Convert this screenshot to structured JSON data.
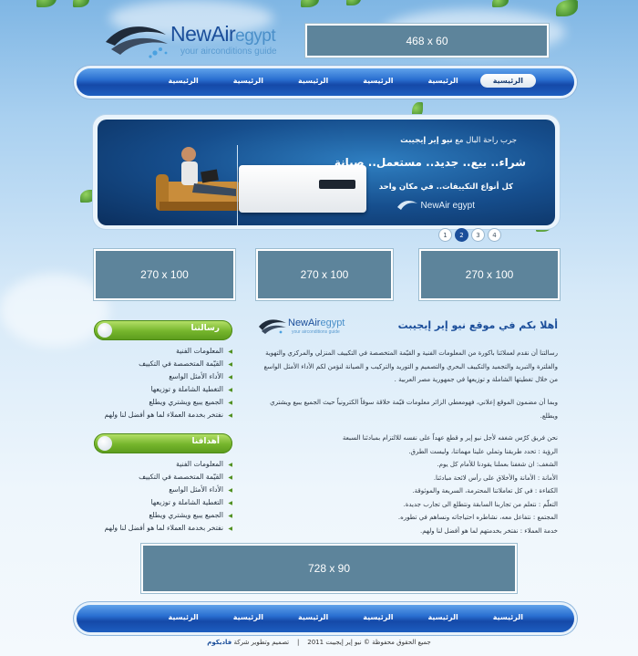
{
  "logo": {
    "name": "NewAir",
    "name_suffix": "egypt",
    "tagline": "your airconditions guide"
  },
  "ads": {
    "top": "468 x 60",
    "box1": "270 x 100",
    "box2": "270 x 100",
    "box3": "270 x 100",
    "bottom": "728 x 90"
  },
  "nav": {
    "items": [
      "الرئيسية",
      "الرئيسية",
      "الرئيسية",
      "الرئيسية",
      "الرئيسية",
      "الرئيسية"
    ]
  },
  "banner": {
    "line1_pre": "جرب راحة البال مع ",
    "line1_brand": "نيو إير إيجيبت",
    "line2": "شراء.. بيع.. جديد.. مستعمل.. صيانة",
    "line3": "كل أنواع التكييفات.. في مكان واحد",
    "logo": "NewAir egypt"
  },
  "pager": {
    "pages": [
      "1",
      "2",
      "3",
      "4"
    ],
    "active": "2"
  },
  "sidebar": {
    "mission": {
      "title": "رسالتنا",
      "items": [
        "المعلومات الفنية",
        "القيّمة المتخصصة في التكييف",
        "الأداء الأمثل الواسع",
        "التغطية الشاملة و توزيعها",
        "الجميع يبيع ويشتري ويطلع",
        "نفتخر بخدمة العملاء لما هو أفضل لنا ولهم"
      ]
    },
    "goals": {
      "title": "أهدافنا",
      "items": [
        "المعلومات الفنية",
        "القيّمة المتخصصة في التكييف",
        "الأداء الأمثل الواسع",
        "التغطية الشاملة و توزيعها",
        "الجميع يبيع ويشتري ويطلع",
        "نفتخر بخدمة العملاء لما هو أفضل لنا ولهم"
      ]
    }
  },
  "main": {
    "welcome_pre": "أهلا بكم في موقع ",
    "welcome_brand": "نيو إير إيجيبت",
    "p1": "رسالتنا أن نقدم لعملائنا باكورة من المعلومات الفنية و القيّمة المتخصصة في التكييف المنزلي والمركزي والتهوية والفلترة والتبريد والتجميد والتكييف البحري والتصميم و التوريد والتركيب و الصيانة لنؤمن لكم الأداء الأمثل الواسع من خلال تغطيتها الشاملة و توزيعها في جمهورية مصر العربية .",
    "p2": "وبما أن مضمون الموقع إعلاني، فهومعطي الزائر معلومات قيّمة خلاقة سوقاً الكترونياً حيث الجميع يبيع ويشتري ويطلع.",
    "p3": [
      "نحن فريق كرّس شغفه لأجل نيو إير و قطع عهداً على نفسه للالتزام بمبادئنا السبعة",
      "الرؤية : تحدد طريقنا وتملي علينا مهماتنا، وليست الطرق.",
      "الشغف: ان شغفنا بعملنا يقودنا للأمام كل يوم.",
      "الأمانة : الأمانة والأخلاق على رأس لائحة مبادئنا.",
      "الكفاءة : في كل تعاملاتنا المحترمة، السريعة والموثوقة.",
      "التعلّم : نتعلم من تجاربنا السابقة ونتطلع الى تجارب جديدة.",
      "المجتمع : نتفاعل معه، نشاطره احتياجاته ونساهم في تطوره.",
      "خدمة العملاء : نفتخر بخدمتهم لما هو أفضل لنا ولهم."
    ]
  },
  "footer": {
    "nav": [
      "الرئيسية",
      "الرئيسية",
      "الرئيسية",
      "الرئيسية",
      "الرئيسية",
      "الرئيسية"
    ],
    "copyright": "جميع الحقوق محفوظة © نيو إير إيجيبت 2011",
    "sep": "|",
    "credit_pre": "تصميم وتطوير شركة ",
    "credit_brand": "فاديكوم"
  },
  "colors": {
    "brand_blue": "#1b4e9a",
    "nav_blue": "#2a6fd1",
    "green": "#75b52c",
    "ad_box": "#5d849b"
  }
}
